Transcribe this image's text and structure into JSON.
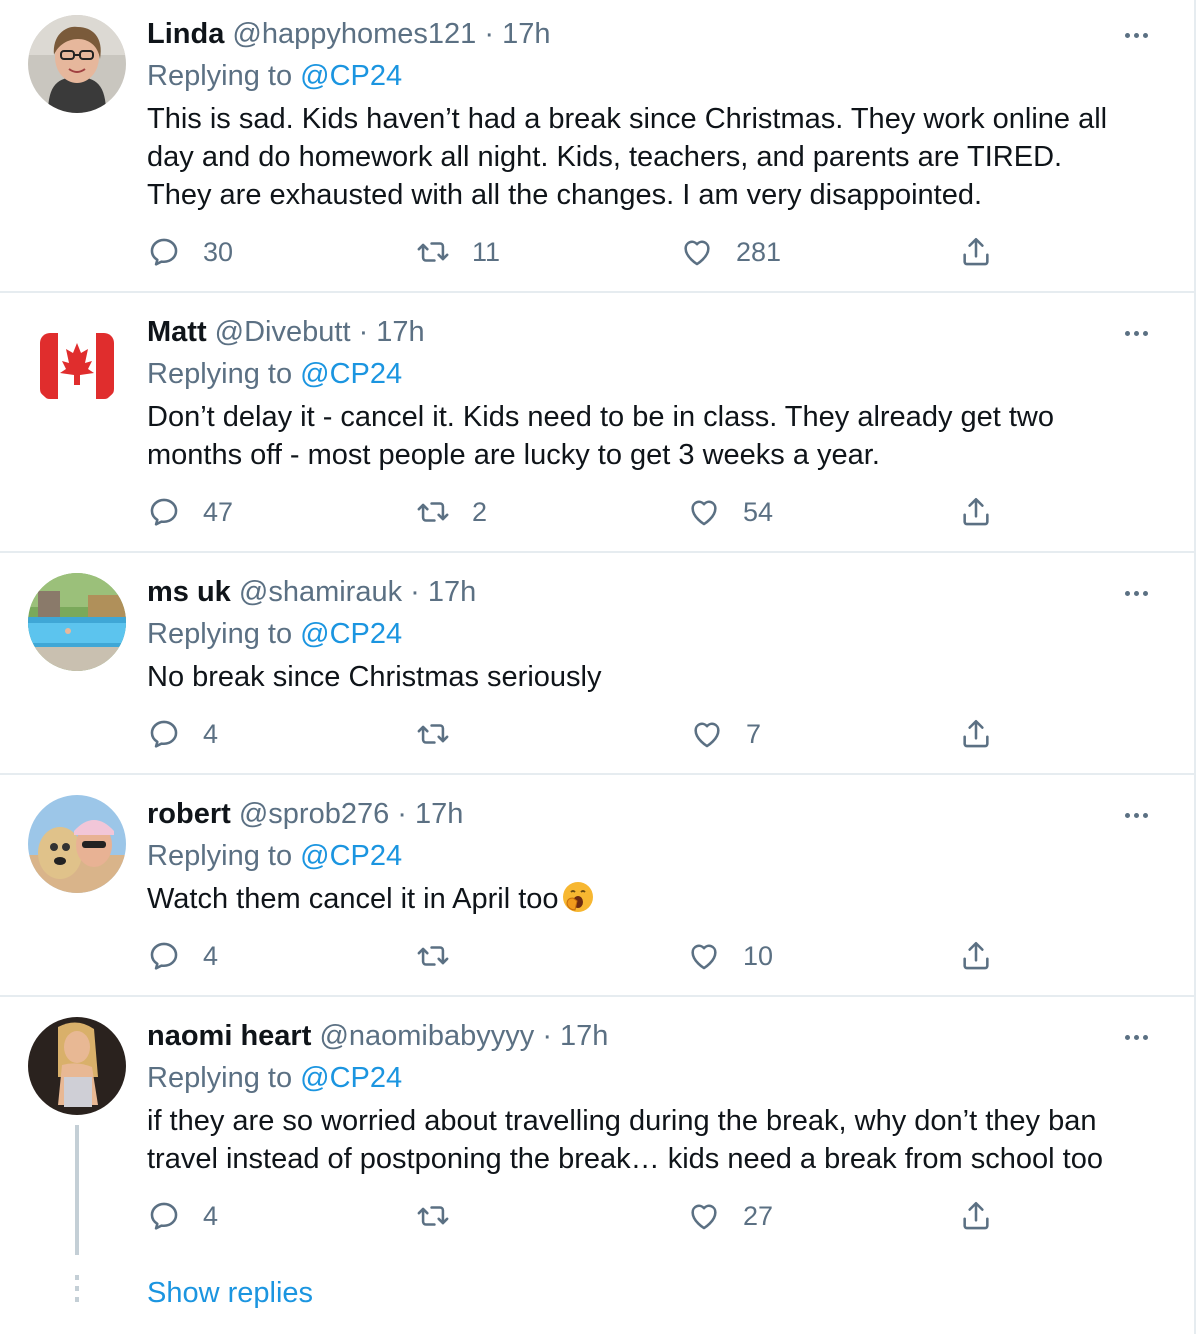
{
  "tweets": [
    {
      "name": "Linda",
      "handle": "@happyhomes121",
      "dot": "·",
      "time": "17h",
      "replying_prefix": "Replying to",
      "replying_to": "@CP24",
      "lines": [
        "This is sad. Kids haven’t had a break since Christmas. They work online all",
        "day and do homework all night. Kids, teachers, and parents are TIRED.",
        "They are exhausted with all the changes. I am very disappointed."
      ],
      "replies": "30",
      "retweets": "11",
      "likes": "281"
    },
    {
      "name": "Matt",
      "handle": "@Divebutt",
      "dot": "·",
      "time": "17h",
      "replying_prefix": "Replying to",
      "replying_to": "@CP24",
      "lines": [
        "Don’t delay it - cancel it. Kids need to be in class. They already get two",
        "months off - most people are lucky to get 3 weeks a year."
      ],
      "replies": "47",
      "retweets": "2",
      "likes": "54"
    },
    {
      "name": "ms uk",
      "handle": "@shamirauk",
      "dot": "·",
      "time": "17h",
      "replying_prefix": "Replying to",
      "replying_to": "@CP24",
      "lines": [
        "No break since Christmas seriously"
      ],
      "replies": "4",
      "retweets": "",
      "likes": "7"
    },
    {
      "name": "robert",
      "handle": "@sprob276",
      "dot": "·",
      "time": "17h",
      "replying_prefix": "Replying to",
      "replying_to": "@CP24",
      "lines": [
        "Watch them cancel it in April too"
      ],
      "replies": "4",
      "retweets": "",
      "likes": "10"
    },
    {
      "name": "naomi heart",
      "handle": "@naomibabyyyy",
      "dot": "·",
      "time": "17h",
      "replying_prefix": "Replying to",
      "replying_to": "@CP24",
      "lines": [
        "if they are so worried about travelling during the break, why don’t they ban",
        "travel instead of postponing the break… kids need a break from school too"
      ],
      "replies": "4",
      "retweets": "",
      "likes": "27"
    }
  ],
  "show_replies": "Show replies",
  "colors": {
    "text": "#0f1419",
    "secondary": "#5b7083",
    "link": "#1b95e0",
    "border": "#e6ecf0"
  },
  "icons": {
    "reply": "reply-icon",
    "retweet": "retweet-icon",
    "like": "heart-icon",
    "share": "share-icon",
    "more": "more-icon"
  }
}
